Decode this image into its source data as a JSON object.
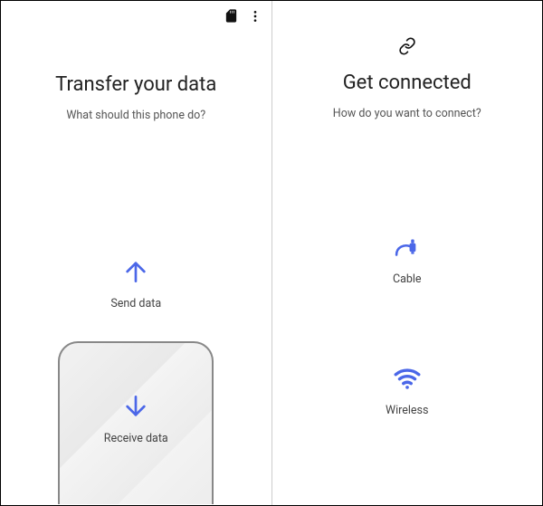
{
  "left": {
    "title": "Transfer your data",
    "subtitle": "What should this phone do?",
    "options": {
      "send": {
        "label": "Send data"
      },
      "receive": {
        "label": "Receive data"
      }
    }
  },
  "right": {
    "title": "Get connected",
    "subtitle": "How do you want to connect?",
    "options": {
      "cable": {
        "label": "Cable"
      },
      "wireless": {
        "label": "Wireless"
      }
    }
  },
  "colors": {
    "accent": "#4b67e8"
  }
}
